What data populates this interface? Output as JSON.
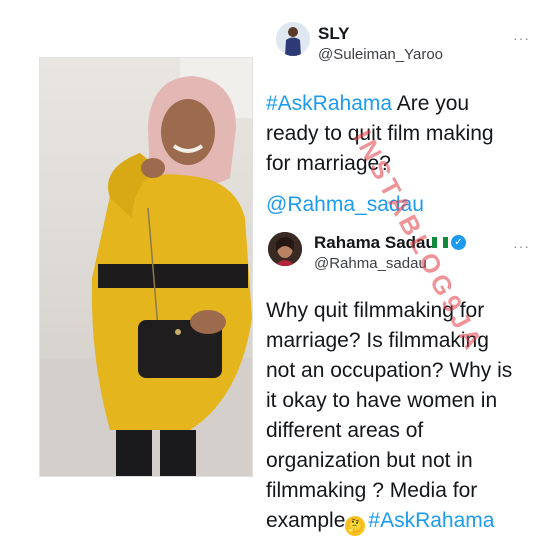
{
  "tweet1": {
    "name": "SLY",
    "handle": "@Suleiman_Yaroo",
    "more": "···",
    "hashtag": "#AskRahama",
    "line1_rest": " Are you",
    "line2": "ready to quit film making",
    "line3": "for marriage?",
    "mention": "@Rahma_sadau"
  },
  "tweet2": {
    "name": "Rahama Sadau",
    "handle": "@Rahma_sadau",
    "more": "···",
    "verified_icon": "✓",
    "lines": [
      "Why quit filmmaking for",
      "marriage? Is filmmaking",
      "not an occupation? Why is",
      "it okay to have women in",
      "different areas of",
      "organization but not in",
      "filmmaking ? Media for"
    ],
    "last_line_text": "example",
    "emoji": "thinking-face",
    "hashtag": "#AskRahama"
  },
  "watermark": "INSTABLOG9JA",
  "colors": {
    "link": "#1d9bf0",
    "text": "#14171a",
    "watermark": "#e03c46",
    "dress": "#e4b51c"
  }
}
